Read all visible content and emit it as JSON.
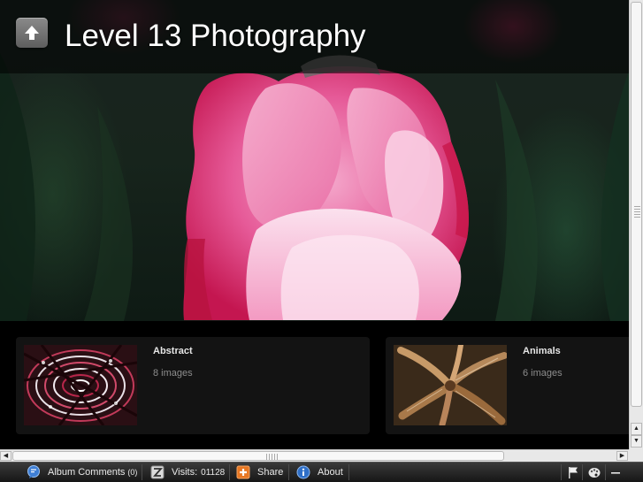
{
  "header": {
    "title": "Level 13 Photography",
    "up_button_icon": "up-arrow-icon"
  },
  "albums": [
    {
      "name": "Abstract",
      "count": "8 images"
    },
    {
      "name": "Animals",
      "count": "6 images"
    }
  ],
  "toolbar": {
    "comments_label": "Album Comments",
    "comments_count": "(0)",
    "visits_label": "Visits:",
    "visits_count": "01128",
    "share_label": "Share",
    "about_label": "About"
  },
  "icons": {
    "comments": "speech-bubble-icon",
    "visits": "counter-icon",
    "share": "plus-icon",
    "about": "info-icon",
    "flag": "flag-icon",
    "theme": "palette-icon",
    "minimize": "minimize-icon"
  },
  "colors": {
    "accent_share": "#e87722",
    "accent_about": "#2f6fc7",
    "title_text": "#ffffff"
  }
}
